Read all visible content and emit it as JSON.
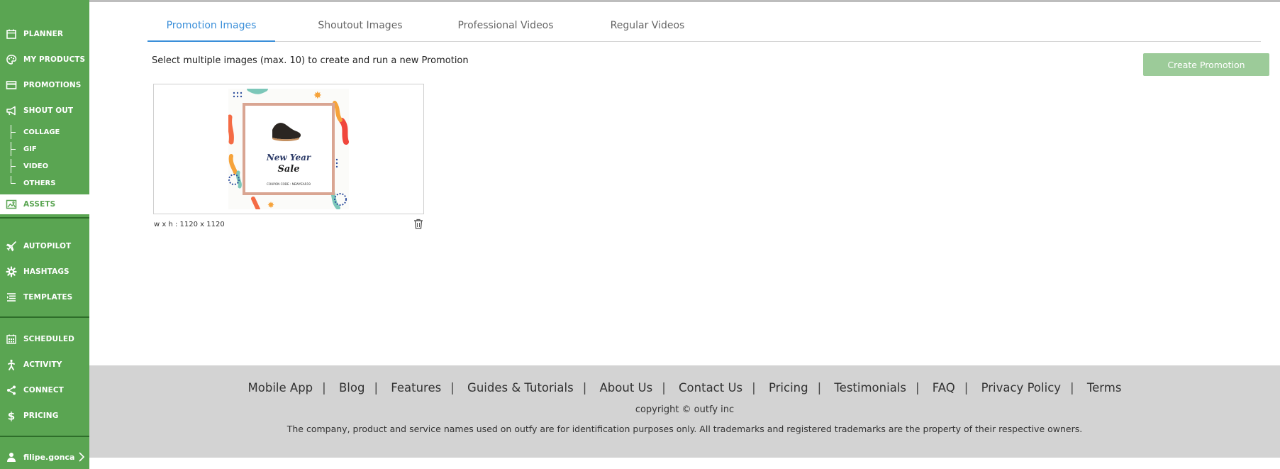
{
  "sidebar": {
    "items": [
      {
        "label": "PLANNER",
        "icon": "calendar-icon"
      },
      {
        "label": "MY PRODUCTS",
        "icon": "palette-icon"
      },
      {
        "label": "PROMOTIONS",
        "icon": "card-icon"
      },
      {
        "label": "SHOUT OUT",
        "icon": "megaphone-icon"
      },
      {
        "label": "ASSETS",
        "icon": "image-icon"
      },
      {
        "label": "AUTOPILOT",
        "icon": "airplane-icon"
      },
      {
        "label": "HASHTAGS",
        "icon": "gear-icon"
      },
      {
        "label": "TEMPLATES",
        "icon": "list-icon"
      },
      {
        "label": "SCHEDULED",
        "icon": "calendar-grid-icon"
      },
      {
        "label": "ACTIVITY",
        "icon": "person-running-icon"
      },
      {
        "label": "CONNECT",
        "icon": "share-icon"
      },
      {
        "label": "PRICING",
        "icon": "dollar-icon"
      }
    ],
    "sub_items": [
      "COLLAGE",
      "GIF",
      "VIDEO",
      "OTHERS"
    ],
    "user": "filipe.gonca",
    "active": "ASSETS",
    "colors": {
      "background": "#5aa552",
      "divider": "#2e6e2a"
    }
  },
  "tabs": [
    {
      "label": "Promotion Images",
      "active": true
    },
    {
      "label": "Shoutout Images",
      "active": false
    },
    {
      "label": "Professional Videos",
      "active": false
    },
    {
      "label": "Regular Videos",
      "active": false
    }
  ],
  "main": {
    "instruction": "Select multiple images (max. 10) to create and run a new Promotion",
    "create_button": "Create Promotion",
    "asset": {
      "dimensions": "w x h : 1120 x 1120",
      "title_line1": "New Year",
      "title_line2": "Sale",
      "coupon": "COUPON CODE : NEWYEAR19"
    }
  },
  "footer": {
    "links": [
      "Mobile App",
      "Blog",
      "Features",
      "Guides & Tutorials",
      "About Us",
      "Contact Us",
      "Pricing",
      "Testimonials",
      "FAQ",
      "Privacy Policy",
      "Terms"
    ],
    "copyright": "copyright © outfy inc",
    "disclaimer": "The company, product and service names used on outfy are for identification purposes only. All trademarks and registered trademarks are the property of their respective owners."
  },
  "colors": {
    "accent_tab": "#3b8fd9",
    "button": "#9ccb99",
    "footer_bg": "#d3d3d3"
  }
}
